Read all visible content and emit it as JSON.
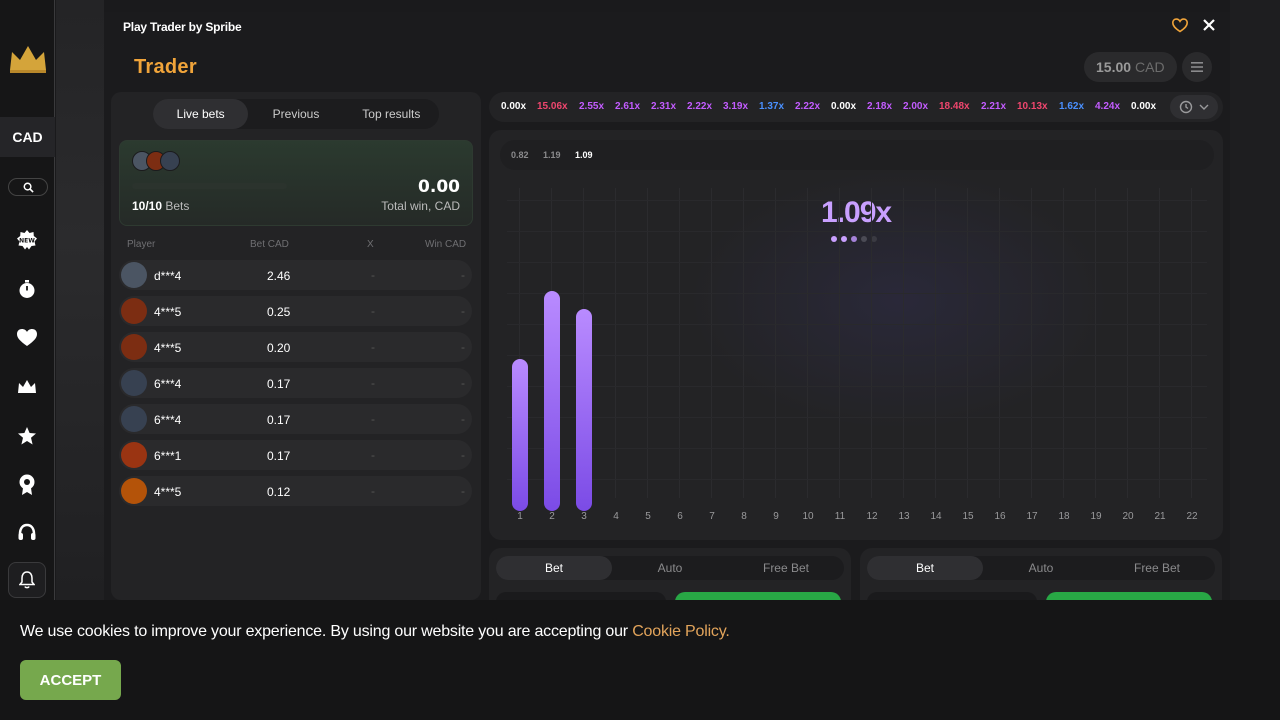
{
  "sidebar": {
    "currency": "CAD",
    "icons": [
      "crown-logo-icon",
      "search-icon",
      "new-badge-icon",
      "stopwatch-icon",
      "heart-icon",
      "crown-icon",
      "star-icon",
      "medal-icon",
      "headset-icon",
      "bell-icon"
    ]
  },
  "modal": {
    "title": "Play Trader by Spribe",
    "game_name": "Trader",
    "balance_amount": "15.00",
    "balance_currency": "CAD"
  },
  "bets": {
    "tabs": [
      "Live bets",
      "Previous",
      "Top results"
    ],
    "active_tab": "Live bets",
    "count_current": "10/10",
    "count_label": "Bets",
    "total_win_value": "0.00",
    "total_win_label": "Total win, CAD",
    "columns": [
      "Player",
      "Bet CAD",
      "X",
      "Win CAD"
    ],
    "rows": [
      {
        "player": "d***4",
        "bet": "2.46",
        "x": "-",
        "win": "-",
        "avatar_color": "#4b5563"
      },
      {
        "player": "4***5",
        "bet": "0.25",
        "x": "-",
        "win": "-",
        "avatar_color": "#7c2d12"
      },
      {
        "player": "4***5",
        "bet": "0.20",
        "x": "-",
        "win": "-",
        "avatar_color": "#7c2d12"
      },
      {
        "player": "6***4",
        "bet": "0.17",
        "x": "-",
        "win": "-",
        "avatar_color": "#374151"
      },
      {
        "player": "6***4",
        "bet": "0.17",
        "x": "-",
        "win": "-",
        "avatar_color": "#374151"
      },
      {
        "player": "6***1",
        "bet": "0.17",
        "x": "-",
        "win": "-",
        "avatar_color": "#9a3412"
      },
      {
        "player": "4***5",
        "bet": "0.12",
        "x": "-",
        "win": "-",
        "avatar_color": "#b45309"
      }
    ]
  },
  "multipliers": [
    {
      "value": "0.00x",
      "color": "#ffffff"
    },
    {
      "value": "15.06x",
      "color": "#f0466e"
    },
    {
      "value": "2.55x",
      "color": "#c35cff"
    },
    {
      "value": "2.61x",
      "color": "#c35cff"
    },
    {
      "value": "2.31x",
      "color": "#c35cff"
    },
    {
      "value": "2.22x",
      "color": "#c35cff"
    },
    {
      "value": "3.19x",
      "color": "#c35cff"
    },
    {
      "value": "1.37x",
      "color": "#4a90ff"
    },
    {
      "value": "2.22x",
      "color": "#c35cff"
    },
    {
      "value": "0.00x",
      "color": "#ffffff"
    },
    {
      "value": "2.18x",
      "color": "#c35cff"
    },
    {
      "value": "2.00x",
      "color": "#c35cff"
    },
    {
      "value": "18.48x",
      "color": "#f0466e"
    },
    {
      "value": "2.21x",
      "color": "#c35cff"
    },
    {
      "value": "10.13x",
      "color": "#f0466e"
    },
    {
      "value": "1.62x",
      "color": "#4a90ff"
    },
    {
      "value": "4.24x",
      "color": "#c35cff"
    },
    {
      "value": "0.00x",
      "color": "#ffffff"
    }
  ],
  "chart": {
    "recent": [
      "0.82",
      "1.19",
      "1.09"
    ],
    "current_multiplier": "1.09x",
    "bars": [
      {
        "x": 1,
        "value": 0.82
      },
      {
        "x": 2,
        "value": 1.19
      },
      {
        "x": 3,
        "value": 1.09
      }
    ],
    "x_ticks": [
      "1",
      "2",
      "3",
      "4",
      "5",
      "6",
      "7",
      "8",
      "9",
      "10",
      "11",
      "12",
      "13",
      "14",
      "15",
      "16",
      "17",
      "18",
      "19",
      "20",
      "21",
      "22"
    ]
  },
  "bet_panels": [
    {
      "tabs": [
        "Bet",
        "Auto",
        "Free Bet"
      ],
      "active": "Bet"
    },
    {
      "tabs": [
        "Bet",
        "Auto",
        "Free Bet"
      ],
      "active": "Bet"
    }
  ],
  "cookie": {
    "text": "We use cookies to improve your experience. By using our website you are accepting our",
    "link": "Cookie Policy.",
    "accept": "ACCEPT"
  },
  "colors": {
    "accent_purple": "#b98bff",
    "brand_orange": "#f0a43a",
    "accept_green": "#76a84d",
    "bet_green": "#28a745"
  }
}
